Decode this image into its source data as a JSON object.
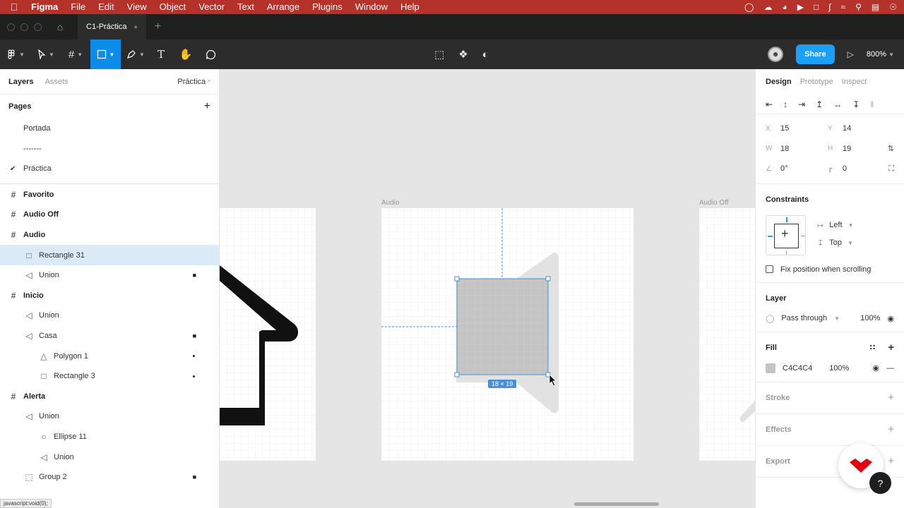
{
  "menubar": {
    "app_name": "Figma",
    "items": [
      "File",
      "Edit",
      "View",
      "Object",
      "Vector",
      "Text",
      "Arrange",
      "Plugins",
      "Window",
      "Help"
    ]
  },
  "tabbar": {
    "file_name": "C1-Práctica"
  },
  "toolbar": {
    "share_label": "Share",
    "zoom": "800%",
    "active_tool": "rectangle"
  },
  "left_panel": {
    "tab_layers": "Layers",
    "tab_assets": "Assets",
    "page_selector": "Práctica",
    "pages_title": "Pages",
    "pages": [
      {
        "label": "Portada",
        "current": false
      },
      {
        "label": "-------",
        "current": false
      },
      {
        "label": "Práctica",
        "current": true
      }
    ],
    "layers": [
      {
        "label": "Favorito",
        "type": "frame",
        "depth": 0
      },
      {
        "label": "Audio Off",
        "type": "frame",
        "depth": 0
      },
      {
        "label": "Audio",
        "type": "frame",
        "depth": 0
      },
      {
        "label": "Rectangle 31",
        "type": "rectangle",
        "depth": 1,
        "selected": true
      },
      {
        "label": "Union",
        "type": "union",
        "depth": 1,
        "locked": true
      },
      {
        "label": "Inicio",
        "type": "frame",
        "depth": 0
      },
      {
        "label": "Union",
        "type": "union",
        "depth": 1
      },
      {
        "label": "Casa",
        "type": "union",
        "depth": 1,
        "locked": true
      },
      {
        "label": "Polygon 1",
        "type": "polygon",
        "depth": 2,
        "dot": true
      },
      {
        "label": "Rectangle 3",
        "type": "rectangle",
        "depth": 2,
        "dot": true
      },
      {
        "label": "Alerta",
        "type": "frame",
        "depth": 0
      },
      {
        "label": "Union",
        "type": "union",
        "depth": 1
      },
      {
        "label": "Ellipse 11",
        "type": "ellipse",
        "depth": 2
      },
      {
        "label": "Union",
        "type": "union",
        "depth": 2
      },
      {
        "label": "Group 2",
        "type": "group",
        "depth": 1,
        "locked": true
      }
    ],
    "status_url": "javascript:void(0);"
  },
  "canvas": {
    "frame_audio_label": "Audio",
    "frame_audio_off_label": "Audio Off",
    "selection_size": "18 × 19"
  },
  "right_panel": {
    "tabs": {
      "design": "Design",
      "prototype": "Prototype",
      "inspect": "Inspect"
    },
    "props": {
      "x_label": "X",
      "x": "15",
      "y_label": "Y",
      "y": "14",
      "w_label": "W",
      "w": "18",
      "h_label": "H",
      "h": "19",
      "rotation": "0°",
      "radius": "0"
    },
    "constraints": {
      "title": "Constraints",
      "horizontal": "Left",
      "vertical": "Top",
      "fix_scroll_label": "Fix position when scrolling"
    },
    "layer": {
      "title": "Layer",
      "blend": "Pass through",
      "opacity": "100%"
    },
    "fill": {
      "title": "Fill",
      "hex": "C4C4C4",
      "opacity": "100%",
      "color": "#c4c4c4"
    },
    "stroke_title": "Stroke",
    "effects_title": "Effects",
    "export_title": "Export"
  },
  "colors": {
    "menubar": "#b5322a",
    "accent": "#0c8ce9",
    "share": "#18a0fb",
    "selection": "#4a90d9",
    "brand_badge": "#e3000f"
  }
}
